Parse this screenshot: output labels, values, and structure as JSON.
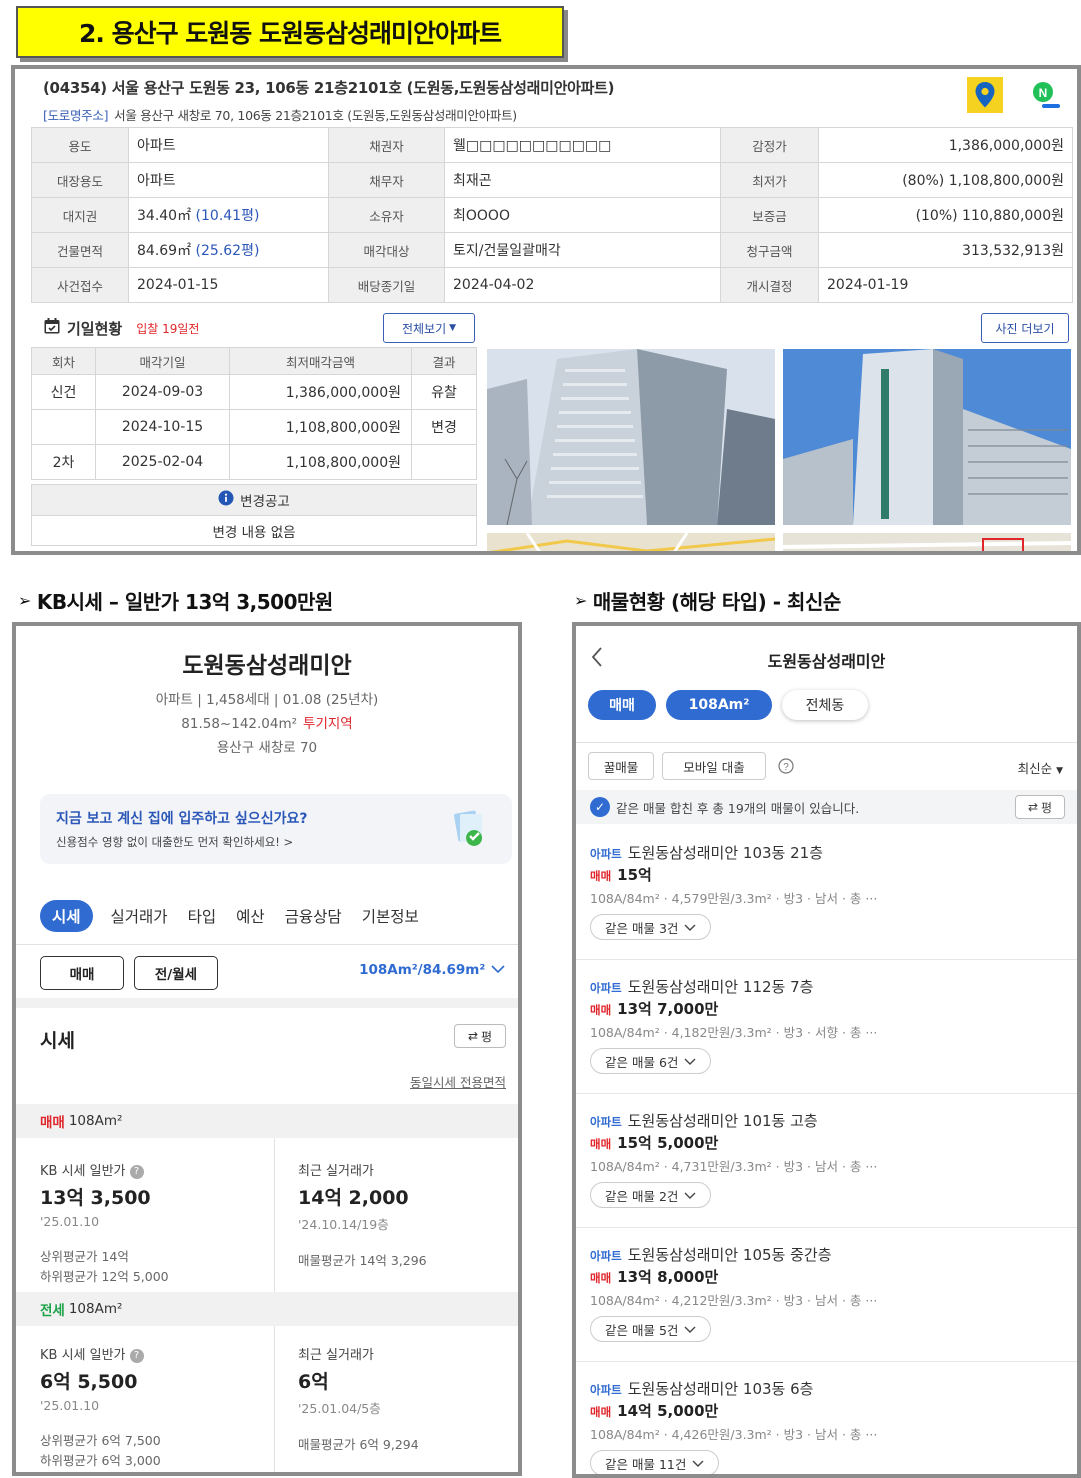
{
  "banner": {
    "title": "2. 용산구 도원동 도원동삼성래미안아파트"
  },
  "auction": {
    "address": "(04354) 서울 용산구 도원동 23, 106동 21층2101호 (도원동,도원동삼성래미안아파트)",
    "road_tag": "[도로명주소]",
    "road_address": "서울 용산구 새창로 70, 106동 21층2101호 (도원동,도원동삼성래미안아파트)",
    "rows": [
      {
        "l1": "용도",
        "v1": "아파트",
        "l2": "채권자",
        "v2": "웰□□□□□□□□□□□",
        "l3": "감정가",
        "v3": "1,386,000,000원"
      },
      {
        "l1": "대장용도",
        "v1": "아파트",
        "l2": "채무자",
        "v2": "최재곤",
        "l3": "최저가",
        "v3": "(80%) 1,108,800,000원"
      },
      {
        "l1": "대지권",
        "v1a": "34.40㎡",
        "v1b": "(10.41평)",
        "l2": "소유자",
        "v2": "최OOOO",
        "l3": "보증금",
        "v3": "(10%) 110,880,000원"
      },
      {
        "l1": "건물면적",
        "v1a": "84.69㎡",
        "v1b": "(25.62평)",
        "l2": "매각대상",
        "v2": "토지/건물일괄매각",
        "l3": "청구금액",
        "v3": "313,532,913원"
      },
      {
        "l1": "사건접수",
        "v1": "2024-01-15",
        "l2": "배당종기일",
        "v2": "2024-04-02",
        "l3": "개시결정",
        "v3": "2024-01-19"
      }
    ],
    "schedule_title": "기일현황",
    "schedule_note": "입찰 19일전",
    "btn_all": "전체보기",
    "btn_photos": "사진 더보기",
    "schedule_headers": [
      "회차",
      "매각기일",
      "최저매각금액",
      "결과"
    ],
    "schedule_rows": [
      {
        "round": "신건",
        "date": "2024-09-03",
        "amount": "1,386,000,000원",
        "result": "유찰"
      },
      {
        "round": "",
        "date": "2024-10-15",
        "amount": "1,108,800,000원",
        "result": "변경"
      },
      {
        "round": "2차",
        "date": "2025-02-04",
        "amount": "1,108,800,000원",
        "result": ""
      }
    ],
    "notice_title": "변경공고",
    "notice_body": "변경 내용 없음"
  },
  "sections": {
    "kb": "KB시세 – 일반가 13억 3,500만원",
    "listings": "매물현황 (해당 타입) - 최신순"
  },
  "kb": {
    "title": "도원동삼성래미안",
    "type": "아파트",
    "households": "1,458세대",
    "built": "01.08 (25년차)",
    "area_range": "81.58~142.04m²",
    "zone": "투기지역",
    "road": "용산구 새창로 70",
    "promo_title": "지금 보고 계신 집에 입주하고 싶으신가요?",
    "promo_sub": "신용점수 영향 없이 대출한도 먼저 확인하세요! >",
    "tabs": [
      "시세",
      "실거래가",
      "타입",
      "예산",
      "금융상담",
      "기본정보"
    ],
    "seg_sale": "매매",
    "seg_rent": "전/월세",
    "area_select": "108Am²/84.69m²",
    "section_title": "시세",
    "unit_btn": "평",
    "link": "동일시세 전용면적",
    "sale": {
      "label": "매매",
      "type": "108Am²",
      "kb_label": "KB 시세 일반가",
      "kb_value": "13억 3,500",
      "kb_date": "'25.01.10",
      "upper": "상위평균가 14억",
      "lower": "하위평균가 12억 5,000",
      "recent_label": "최근 실거래가",
      "recent_value": "14억 2,000",
      "recent_date": "'24.10.14/19층",
      "listing_avg": "매물평균가 14억 3,296"
    },
    "jeonse": {
      "label": "전세",
      "type": "108Am²",
      "kb_label": "KB 시세 일반가",
      "kb_value": "6억 5,500",
      "kb_date": "'25.01.10",
      "upper": "상위평균가 6억 7,500",
      "lower": "하위평균가 6억 3,000",
      "recent_label": "최근 실거래가",
      "recent_value": "6억",
      "recent_date": "'25.01.04/5층",
      "listing_avg": "매물평균가 6억 9,294"
    }
  },
  "listings": {
    "title": "도원동삼성래미안",
    "chips": [
      "매매",
      "108Am²",
      "전체동"
    ],
    "filters": [
      "꿀매물",
      "모바일 대출"
    ],
    "sort": "최신순",
    "info": "같은 매물 합친 후 총 19개의 매물이 있습니다.",
    "unit_btn": "평",
    "items": [
      {
        "kind": "아파트",
        "name": "도원동삼성래미안 103동 21층",
        "deal": "매매",
        "price": "15억",
        "meta": "108A/84m² · 4,579만원/3.3m² · 방3 · 남서 · 총 ···",
        "same": "같은 매물 3건"
      },
      {
        "kind": "아파트",
        "name": "도원동삼성래미안 112동 7층",
        "deal": "매매",
        "price": "13억 7,000만",
        "meta": "108A/84m² · 4,182만원/3.3m² · 방3 · 서향 · 총 ···",
        "same": "같은 매물 6건"
      },
      {
        "kind": "아파트",
        "name": "도원동삼성래미안 101동 고층",
        "deal": "매매",
        "price": "15억 5,000만",
        "meta": "108A/84m² · 4,731만원/3.3m² · 방3 · 남서 · 총 ···",
        "same": "같은 매물 2건"
      },
      {
        "kind": "아파트",
        "name": "도원동삼성래미안 105동 중간층",
        "deal": "매매",
        "price": "13억 8,000만",
        "meta": "108A/84m² · 4,212만원/3.3m² · 방3 · 남서 · 총 ···",
        "same": "같은 매물 5건"
      },
      {
        "kind": "아파트",
        "name": "도원동삼성래미안 103동 6층",
        "deal": "매매",
        "price": "14억 5,000만",
        "meta": "108A/84m² · 4,426만원/3.3m² · 방3 · 남서 · 총 ···",
        "same": "같은 매물 11건"
      }
    ]
  }
}
